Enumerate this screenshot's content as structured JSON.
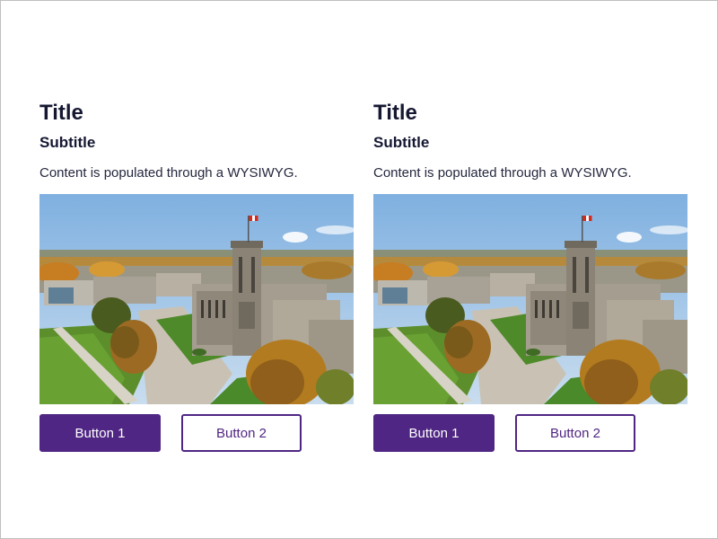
{
  "cards": [
    {
      "title": "Title",
      "subtitle": "Subtitle",
      "content": "Content is populated through a WYSIWYG.",
      "image_subject": "aerial campus photo with stone clock tower and Canadian flag",
      "button1_label": "Button 1",
      "button2_label": "Button 2"
    },
    {
      "title": "Title",
      "subtitle": "Subtitle",
      "content": "Content is populated through a WYSIWYG.",
      "image_subject": "aerial campus photo with stone clock tower and Canadian flag",
      "button1_label": "Button 1",
      "button2_label": "Button 2"
    }
  ],
  "colors": {
    "brand_purple": "#4f2683",
    "heading_text": "#161832",
    "body_text": "#25283e",
    "frame_border": "#bfbfbf"
  }
}
